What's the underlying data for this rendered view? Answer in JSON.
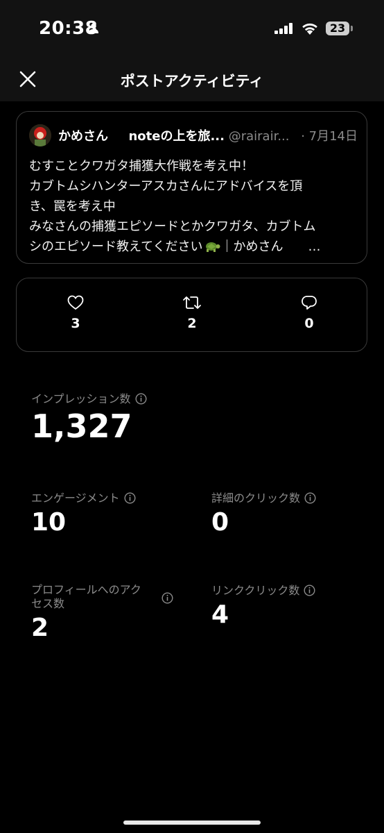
{
  "status": {
    "time": "20:38",
    "battery": "23"
  },
  "nav": {
    "title": "ポストアクティビティ"
  },
  "tweet": {
    "name": "かめさん",
    "topic": "noteの上を旅...",
    "handle": "@rairair...",
    "date": "· 7月14日",
    "lines": [
      "むすことクワガタ捕獲大作戦を考え中！",
      "カブトムシハンターアスカさんにアドバイスを頂",
      "き、罠を考え中",
      "みなさんの捕獲エピソードとかクワガタ、カブトム",
      "シのエピソード教えてください",
      "｜かめさん　　…"
    ]
  },
  "metrics": {
    "likes": "3",
    "reposts": "2",
    "replies": "0"
  },
  "stats": {
    "impressions": {
      "label": "インプレッション数",
      "value": "1,327"
    },
    "engagement": {
      "label": "エンゲージメント",
      "value": "10"
    },
    "detail_clicks": {
      "label": "詳細のクリック数",
      "value": "0"
    },
    "profile_visits": {
      "label_line1": "プロフィールへのアク",
      "label_line2": "セス数",
      "value": "2"
    },
    "link_clicks": {
      "label": "リンククリック数",
      "value": "4"
    }
  },
  "icons": {
    "close": "close-icon",
    "like": "heart-icon",
    "repost": "repost-icon",
    "reply": "reply-icon",
    "info": "info-icon"
  },
  "colors": {
    "background": "#000000",
    "muted_text": "#8b8b8b",
    "card_border": "#3a3a3a"
  }
}
